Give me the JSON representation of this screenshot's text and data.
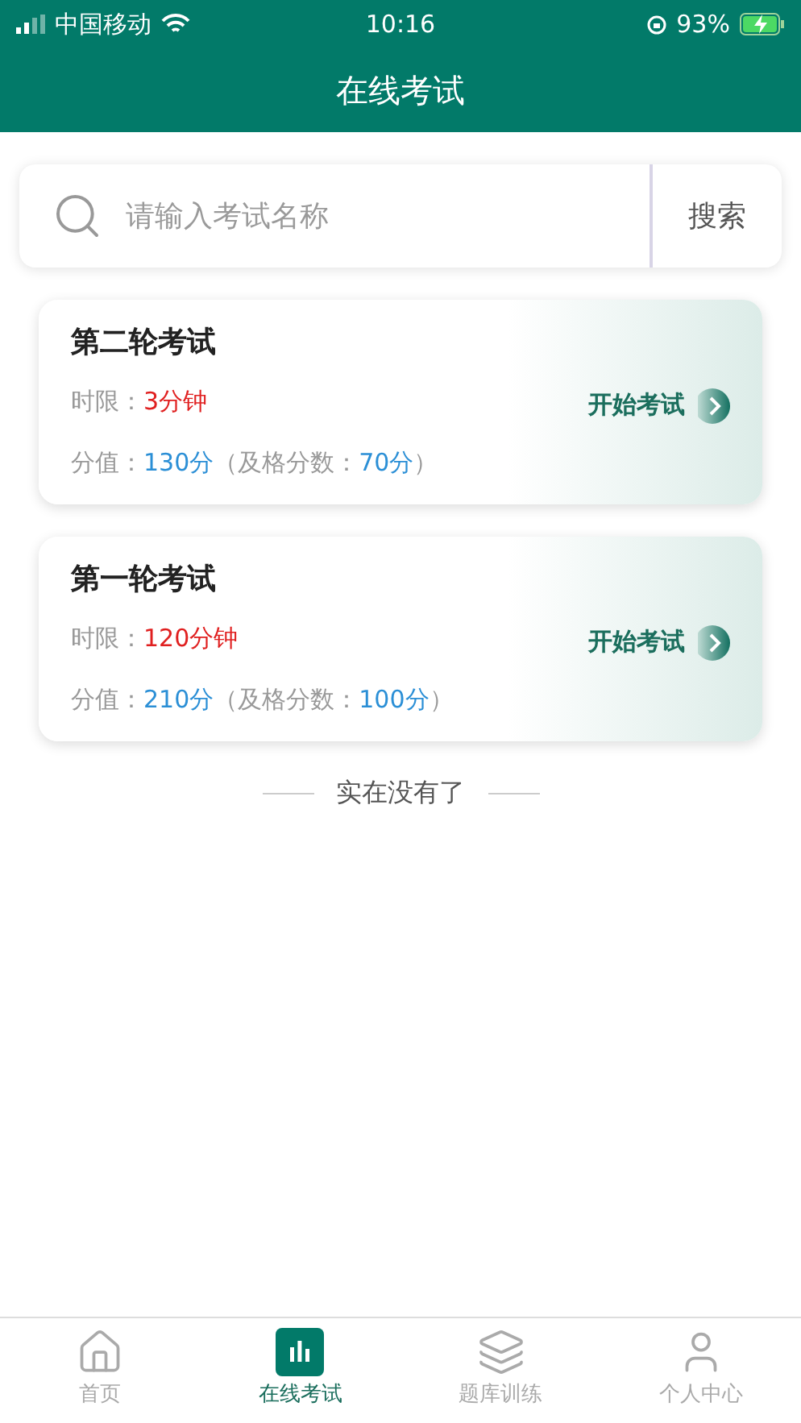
{
  "status_bar": {
    "carrier": "中国移动",
    "time": "10:16",
    "battery": "93%"
  },
  "header": {
    "title": "在线考试"
  },
  "search": {
    "placeholder": "请输入考试名称",
    "button": "搜索"
  },
  "exams": [
    {
      "title": "第二轮考试",
      "time_label": "时限：",
      "time_value": "3分钟",
      "score_label": "分值：",
      "score_value": "130分",
      "pass_label": "（及格分数：",
      "pass_value": "70分",
      "pass_end": "）",
      "action": "开始考试"
    },
    {
      "title": "第一轮考试",
      "time_label": "时限：",
      "time_value": "120分钟",
      "score_label": "分值：",
      "score_value": "210分",
      "pass_label": "（及格分数：",
      "pass_value": "100分",
      "pass_end": "）",
      "action": "开始考试"
    }
  ],
  "end_text": "实在没有了",
  "tabs": [
    {
      "kind": "home",
      "label": "首页",
      "selected": false
    },
    {
      "kind": "exam",
      "label": "在线考试",
      "selected": true
    },
    {
      "kind": "bank",
      "label": "题库训练",
      "selected": false
    },
    {
      "kind": "user",
      "label": "个人中心",
      "selected": false
    }
  ]
}
